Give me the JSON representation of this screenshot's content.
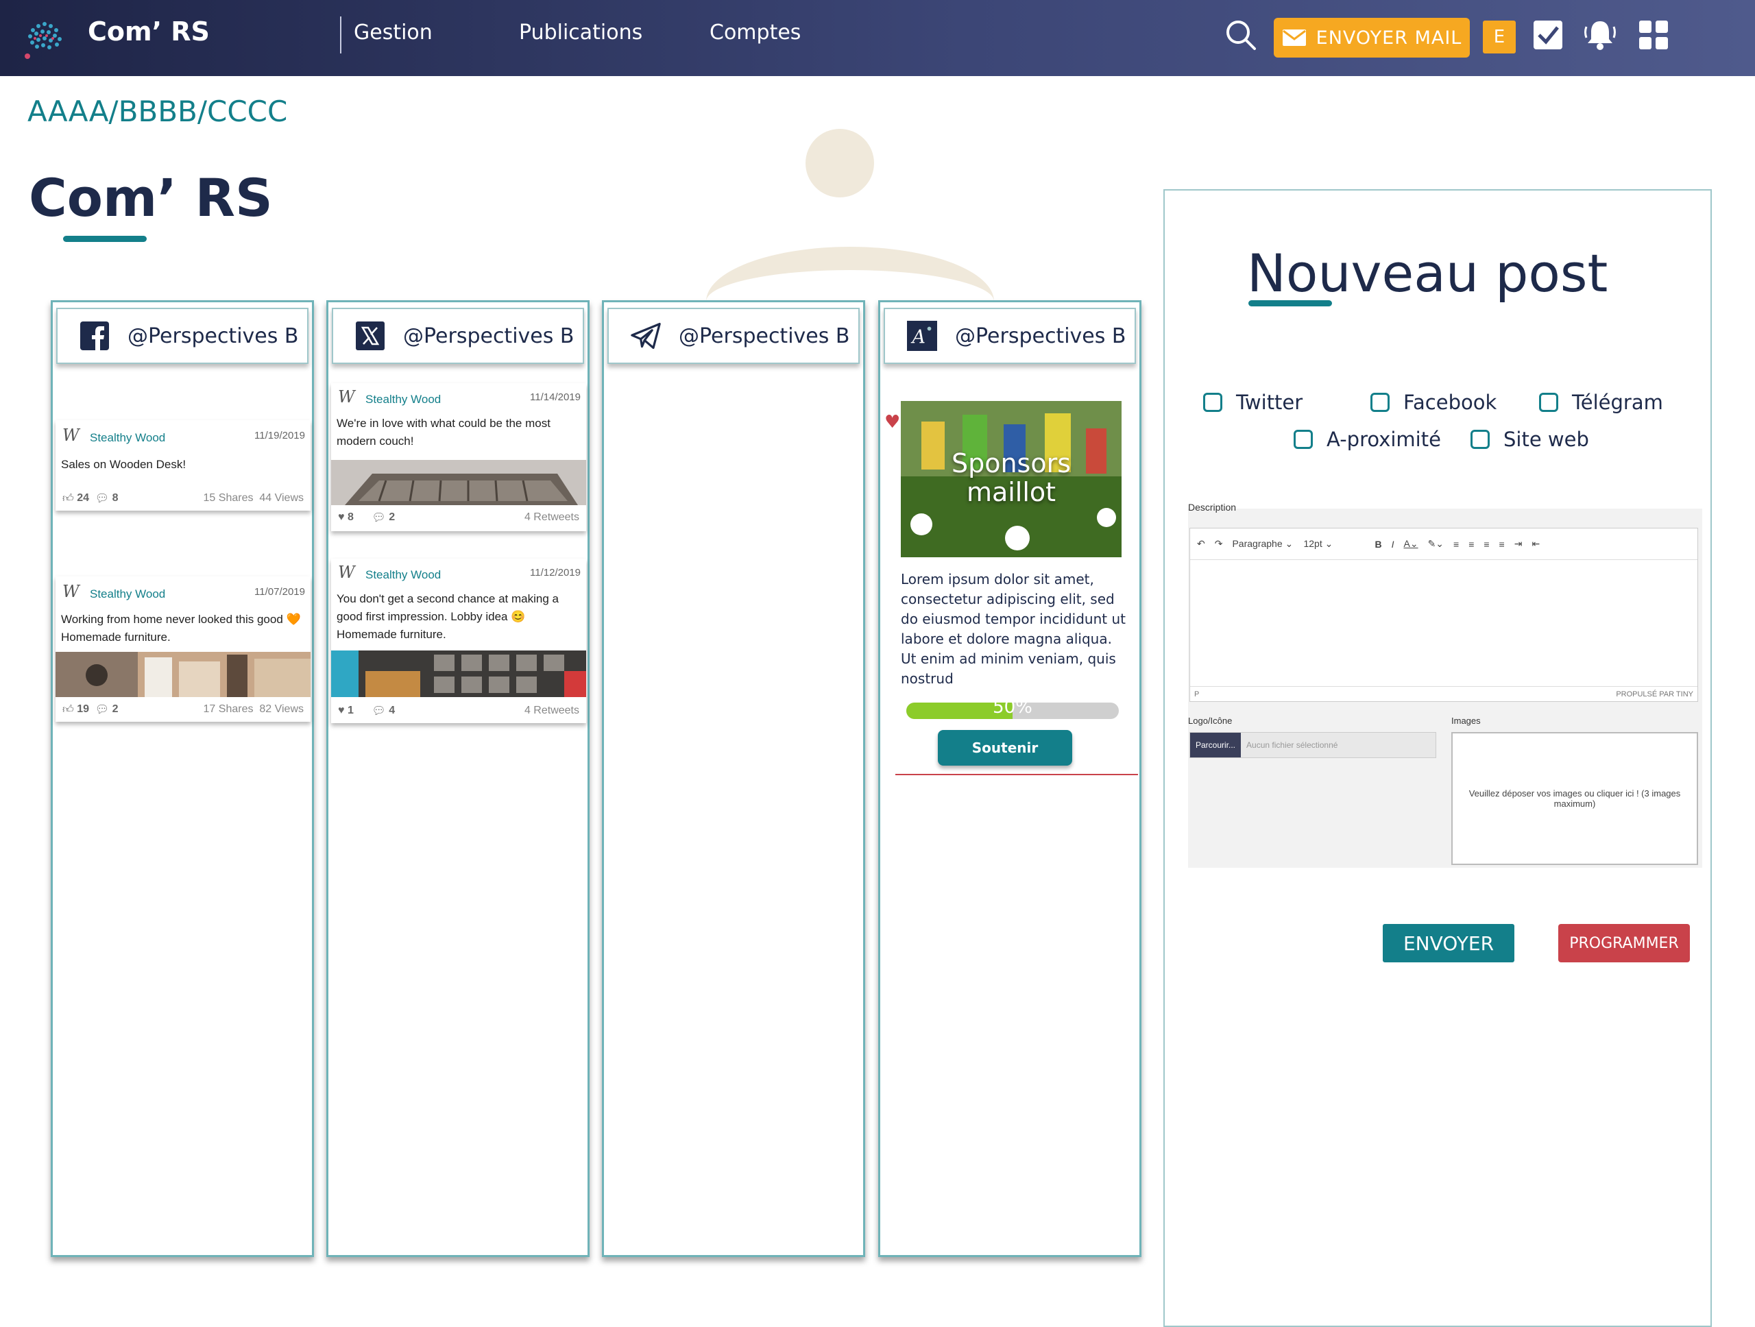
{
  "topbar": {
    "app_name": "Com’ RS",
    "nav": [
      "Gestion",
      "Publications",
      "Comptes"
    ],
    "mail_label": "ENVOYER  MAIL",
    "user_initial": "E",
    "icons": [
      "search-icon",
      "mail-icon",
      "check-icon",
      "bell-icon",
      "grid-icon"
    ],
    "accent": "#f6a821"
  },
  "breadcrumb": "AAAA/BBBB/CCCC",
  "page_title": "Com’ RS",
  "columns": [
    {
      "network": "facebook",
      "handle": "@Perspectives B",
      "posts": [
        {
          "author": "Stealthy Wood",
          "date": "11/19/2019",
          "text": "Sales on Wooden Desk!",
          "likes": "24",
          "comments": "8",
          "shares": "15 Shares",
          "views": "44 Views"
        },
        {
          "author": "Stealthy Wood",
          "date": "11/07/2019",
          "text": "Working from home never looked this good 🧡 Homemade furniture.",
          "likes": "19",
          "comments": "2",
          "shares": "17 Shares",
          "views": "82 Views"
        }
      ]
    },
    {
      "network": "x",
      "handle": "@Perspectives B",
      "posts": [
        {
          "author": "Stealthy Wood",
          "date": "11/14/2019",
          "text": "We're in love with what could be the most modern couch!",
          "likes": "8",
          "comments": "2",
          "retweets": "4 Retweets"
        },
        {
          "author": "Stealthy Wood",
          "date": "11/12/2019",
          "text": "You don't get a second chance at making a good first impression. Lobby idea 😊 Homemade furniture.",
          "likes": "1",
          "comments": "4",
          "retweets": "4 Retweets"
        }
      ]
    },
    {
      "network": "telegram",
      "handle": "@Perspectives B",
      "posts": []
    },
    {
      "network": "proximite",
      "handle": "@Perspectives B",
      "campaign": {
        "image_caption": "Sponsors maillot",
        "text": "Lorem ipsum dolor sit amet, consectetur adipiscing elit, sed do eiusmod tempor incididunt ut labore et dolore magna aliqua. Ut enim ad minim veniam, quis nostrud",
        "progress": 0.5,
        "progress_label": "50%",
        "button": "Soutenir"
      }
    }
  ],
  "new_post": {
    "title": "Nouveau post",
    "targets": [
      "Twitter",
      "Facebook",
      "Télégram",
      "A-proximité",
      "Site web"
    ],
    "description_label": "Description",
    "toolbar": {
      "format": "Paragraphe",
      "size": "12pt"
    },
    "footer_left": "P",
    "footer_right": "PROPULSÉ PAR TINY",
    "logo_label": "Logo/Icône",
    "browse_label": "Parcourir...",
    "file_placeholder": "Aucun fichier sélectionné",
    "images_label": "Images",
    "images_hint": "Veuillez déposer vos images ou cliquer ici ! (3 images maximum)",
    "send": "ENVOYER",
    "schedule": "PROGRAMMER"
  },
  "colors": {
    "teal": "#137f8a",
    "navy": "#1e2a4a",
    "red": "#c9424a",
    "progress": "#8ccc2a"
  }
}
